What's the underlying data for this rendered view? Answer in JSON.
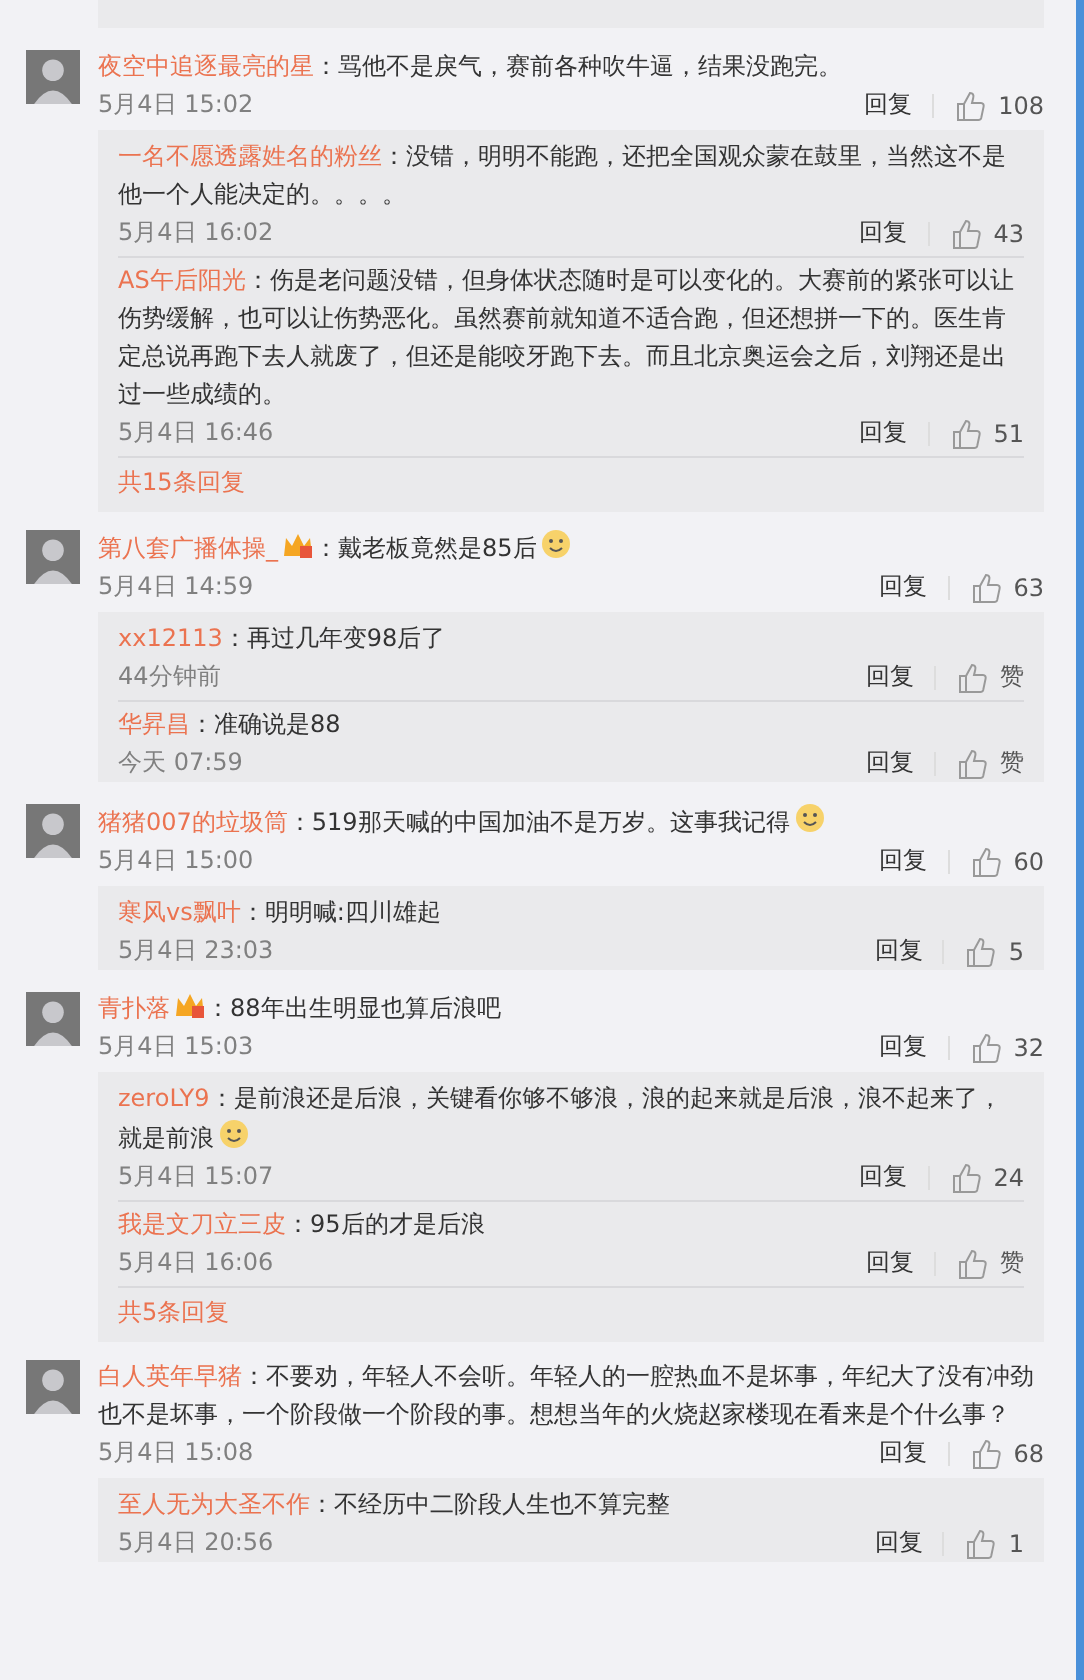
{
  "comments": [
    {
      "user": "夜空中追逐最亮的星",
      "badge": false,
      "text": "：骂他不是戾气，赛前各种吹牛逼，结果没跑完。",
      "emoji": false,
      "time": "5月4日 15:02",
      "reply_label": "回复",
      "likes": "108",
      "replies": [
        {
          "user": "一名不愿透露姓名的粉丝",
          "text": "：没错，明明不能跑，还把全国观众蒙在鼓里，当然这不是他一个人能决定的。。。。",
          "emoji": false,
          "time": "5月4日 16:02",
          "reply_label": "回复",
          "likes": "43"
        },
        {
          "user": "AS午后阳光",
          "text": "：伤是老问题没错，但身体状态随时是可以变化的。大赛前的紧张可以让伤势缓解，也可以让伤势恶化。虽然赛前就知道不适合跑，但还想拼一下的。医生肯定总说再跑下去人就废了，但还是能咬牙跑下去。而且北京奥运会之后，刘翔还是出过一些成绩的。",
          "emoji": false,
          "time": "5月4日 16:46",
          "reply_label": "回复",
          "likes": "51"
        }
      ],
      "more": "共15条回复"
    },
    {
      "user": "第八套广播体操_",
      "badge": true,
      "text": "：戴老板竟然是85后",
      "emoji": true,
      "time": "5月4日 14:59",
      "reply_label": "回复",
      "likes": "63",
      "replies": [
        {
          "user": "xx12113",
          "text": "：再过几年变98后了",
          "emoji": false,
          "time": "44分钟前",
          "reply_label": "回复",
          "likes": "赞"
        },
        {
          "user": "华昇昌",
          "text": "：准确说是88",
          "emoji": false,
          "time": "今天 07:59",
          "reply_label": "回复",
          "likes": "赞"
        }
      ]
    },
    {
      "user": "猪猪007的垃圾筒",
      "badge": false,
      "text": "：519那天喊的中国加油不是万岁。这事我记得",
      "emoji": true,
      "time": "5月4日 15:00",
      "reply_label": "回复",
      "likes": "60",
      "replies": [
        {
          "user": "寒风vs飘叶",
          "text": "：明明喊:四川雄起",
          "emoji": false,
          "time": "5月4日 23:03",
          "reply_label": "回复",
          "likes": "5"
        }
      ]
    },
    {
      "user": "青扑落",
      "badge": true,
      "text": "：88年出生明显也算后浪吧",
      "emoji": false,
      "time": "5月4日 15:03",
      "reply_label": "回复",
      "likes": "32",
      "replies": [
        {
          "user": "zeroLY9",
          "text": "：是前浪还是后浪，关键看你够不够浪，浪的起来就是后浪，浪不起来了，就是前浪",
          "emoji": true,
          "time": "5月4日 15:07",
          "reply_label": "回复",
          "likes": "24"
        },
        {
          "user": "我是文刀立三皮",
          "text": "：95后的才是后浪",
          "emoji": false,
          "time": "5月4日 16:06",
          "reply_label": "回复",
          "likes": "赞"
        }
      ],
      "more": "共5条回复"
    },
    {
      "user": "白人英年早猪",
      "badge": false,
      "text": "：不要劝，年轻人不会听。年轻人的一腔热血不是坏事，年纪大了没有冲劲也不是坏事，一个阶段做一个阶段的事。想想当年的火烧赵家楼现在看来是个什么事？",
      "emoji": false,
      "time": "5月4日 15:08",
      "reply_label": "回复",
      "likes": "68",
      "replies": [
        {
          "user": "至人无为大圣不作",
          "text": "：不经历中二阶段人生也不算完整",
          "emoji": false,
          "time": "5月4日 20:56",
          "reply_label": "回复",
          "likes": "1"
        }
      ]
    }
  ]
}
